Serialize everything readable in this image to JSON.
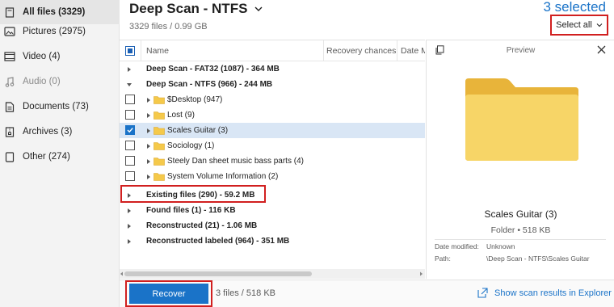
{
  "sidebar": {
    "items": [
      {
        "label": "All files (3329)",
        "icon": "files-icon",
        "state": "active"
      },
      {
        "label": "Pictures (2975)",
        "icon": "picture-icon",
        "state": "normal"
      },
      {
        "label": "Video (4)",
        "icon": "video-icon",
        "state": "normal"
      },
      {
        "label": "Audio (0)",
        "icon": "music-icon",
        "state": "disabled"
      },
      {
        "label": "Documents (73)",
        "icon": "document-icon",
        "state": "normal"
      },
      {
        "label": "Archives (3)",
        "icon": "archive-icon",
        "state": "normal"
      },
      {
        "label": "Other (274)",
        "icon": "other-file-icon",
        "state": "normal"
      }
    ]
  },
  "header": {
    "title": "Deep Scan - NTFS",
    "subtitle": "3329 files / 0.99 GB",
    "selected_count": "3 selected",
    "select_all_label": "Select all"
  },
  "table": {
    "columns": [
      "Name",
      "Recovery chances",
      "Date M"
    ],
    "rows": [
      {
        "label": "Deep Scan - FAT32 (1087) - 364 MB",
        "type": "group",
        "expanded": false
      },
      {
        "label": "Deep Scan - NTFS (966) - 244 MB",
        "type": "group",
        "expanded": true
      },
      {
        "label": "$Desktop (947)",
        "type": "folder",
        "checked": false
      },
      {
        "label": "Lost (9)",
        "type": "folder",
        "checked": false
      },
      {
        "label": "Scales Guitar (3)",
        "type": "folder",
        "checked": true
      },
      {
        "label": "Sociology (1)",
        "type": "folder",
        "checked": false
      },
      {
        "label": "Steely Dan sheet music bass parts (4)",
        "type": "folder",
        "checked": false
      },
      {
        "label": "System Volume Information (2)",
        "type": "folder",
        "checked": false
      },
      {
        "label": "Existing files (290) - 59.2 MB",
        "type": "group",
        "expanded": false
      },
      {
        "label": "Found files (1) - 116 KB",
        "type": "group",
        "expanded": false
      },
      {
        "label": "Reconstructed (21) - 1.06 MB",
        "type": "group",
        "expanded": false
      },
      {
        "label": "Reconstructed labeled (964) - 351 MB",
        "type": "group",
        "expanded": false
      }
    ]
  },
  "preview": {
    "title": "Preview",
    "name": "Scales Guitar (3)",
    "meta": "Folder • 518 KB",
    "date_modified_label": "Date modified:",
    "date_modified_value": "Unknown",
    "path_label": "Path:",
    "path_value": "\\Deep Scan - NTFS\\Scales Guitar"
  },
  "footer": {
    "recover_label": "Recover",
    "info": "3 files / 518 KB",
    "explorer_link": "Show scan results in Explorer"
  },
  "colors": {
    "accent": "#1a73c8",
    "highlight_border": "#d11f1f",
    "folder": "#f5c94a",
    "selected_row": "#d9e6f5"
  }
}
